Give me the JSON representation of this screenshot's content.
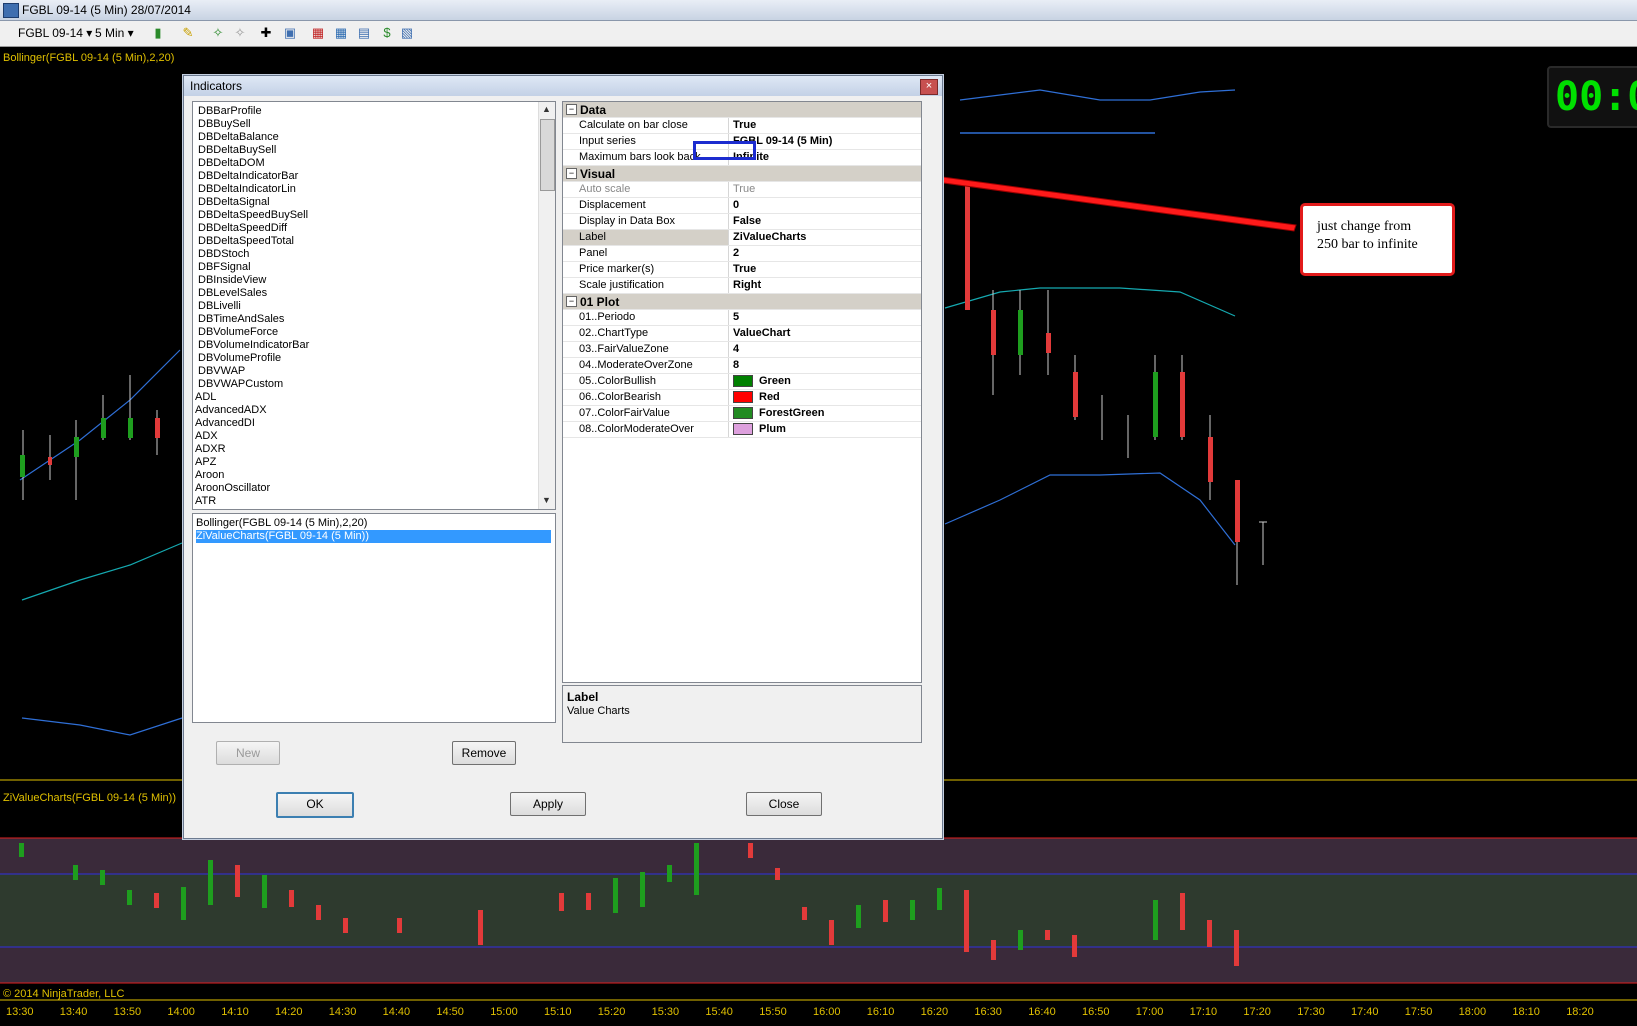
{
  "window": {
    "title": "FGBL 09-14 (5 Min)  28/07/2014"
  },
  "toolbar": {
    "instrument": "FGBL 09-14 ▾",
    "interval": "5 Min ▾"
  },
  "chart": {
    "main_indicator_label": "Bollinger(FGBL 09-14 (5 Min),2,20)",
    "sub_indicator_label": "ZiValueCharts(FGBL 09-14 (5 Min))",
    "clock_text": "00:0",
    "copyright": "© 2014 NinjaTrader, LLC",
    "time_labels": [
      "13:30",
      "13:40",
      "13:50",
      "14:00",
      "14:10",
      "14:20",
      "14:30",
      "14:40",
      "14:50",
      "15:00",
      "15:10",
      "15:20",
      "15:30",
      "15:40",
      "15:50",
      "16:00",
      "16:10",
      "16:20",
      "16:30",
      "16:40",
      "16:50",
      "17:00",
      "17:10",
      "17:20",
      "17:30",
      "17:40",
      "17:50",
      "18:00",
      "18:10",
      "18:20"
    ],
    "colors": {
      "up": "#1e9e1e",
      "down": "#e23a3a",
      "axis": "#e0c000"
    }
  },
  "dialog": {
    "title": "Indicators",
    "close_glyph": "×",
    "indicator_list": [
      "DBBarProfile",
      "DBBuySell",
      "DBDeltaBalance",
      "DBDeltaBuySell",
      "DBDeltaDOM",
      "DBDeltaIndicatorBar",
      "DBDeltaIndicatorLin",
      "DBDeltaSignal",
      "DBDeltaSpeedBuySell",
      "DBDeltaSpeedDiff",
      "DBDeltaSpeedTotal",
      "DBDStoch",
      "DBFSignal",
      "DBInsideView",
      "DBLevelSales",
      "DBLivelli",
      "DBTimeAndSales",
      "DBVolumeForce",
      "DBVolumeIndicatorBar",
      "DBVolumeProfile",
      "DBVWAP",
      "DBVWAPCustom",
      "ADL",
      "AdvancedADX",
      "AdvancedDI",
      "ADX",
      "ADXR",
      "APZ",
      "Aroon",
      "AroonOscillator",
      "ATR"
    ],
    "applied_list": [
      "Bollinger(FGBL 09-14 (5 Min),2,20)",
      "ZiValueCharts(FGBL 09-14 (5 Min))"
    ],
    "buttons": {
      "new": "New",
      "remove": "Remove",
      "ok": "OK",
      "apply": "Apply",
      "close": "Close"
    },
    "properties": {
      "data": {
        "category": "Data",
        "rows": [
          {
            "name": "Calculate on bar close",
            "value": "True"
          },
          {
            "name": "Input series",
            "value": "FGBL 09-14 (5 Min)"
          },
          {
            "name": "Maximum bars look back",
            "value": "Infinite"
          }
        ]
      },
      "visual": {
        "category": "Visual",
        "rows": [
          {
            "name": "Auto scale",
            "value": "True"
          },
          {
            "name": "Displacement",
            "value": "0"
          },
          {
            "name": "Display in Data Box",
            "value": "False"
          },
          {
            "name": "Label",
            "value": "ZiValueCharts"
          },
          {
            "name": "Panel",
            "value": "2"
          },
          {
            "name": "Price marker(s)",
            "value": "True"
          },
          {
            "name": "Scale justification",
            "value": "Right"
          }
        ]
      },
      "plot": {
        "category": "01 Plot",
        "rows": [
          {
            "name": "01..Periodo",
            "value": "5"
          },
          {
            "name": "02..ChartType",
            "value": "ValueChart"
          },
          {
            "name": "03..FairValueZone",
            "value": "4"
          },
          {
            "name": "04..ModerateOverZone",
            "value": "8"
          },
          {
            "name": "05..ColorBullish",
            "value": "Green",
            "color": "#008000"
          },
          {
            "name": "06..ColorBearish",
            "value": "Red",
            "color": "#ff0000"
          },
          {
            "name": "07..ColorFairValue",
            "value": "ForestGreen",
            "color": "#228b22"
          },
          {
            "name": "08..ColorModerateOver",
            "value": "Plum",
            "color": "#dda0dd"
          }
        ]
      }
    },
    "description": {
      "heading": "Label",
      "text": "Value Charts"
    }
  },
  "annotation": {
    "line1": "just change from",
    "line2": "250 bar to infinite"
  }
}
